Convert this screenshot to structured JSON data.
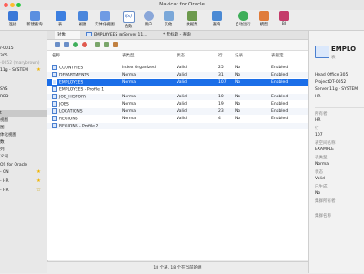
{
  "window": {
    "title": "Navicat for Oracle"
  },
  "colors": {
    "accent": "#1b6ee8",
    "traffic_close": "#ff5f57",
    "traffic_min": "#febc2e",
    "traffic_max": "#28c840"
  },
  "toolbar": [
    {
      "label": "连接",
      "icon": "connection-icon"
    },
    {
      "label": "新建查询",
      "icon": "new-query-icon"
    },
    {
      "label": "表",
      "icon": "table-icon"
    },
    {
      "label": "视图",
      "icon": "view-icon"
    },
    {
      "label": "实体化视图",
      "icon": "materialized-view-icon"
    },
    {
      "label": "函数",
      "icon": "function-icon"
    },
    {
      "label": "用户",
      "icon": "user-icon"
    },
    {
      "label": "其他",
      "icon": "other-icon"
    },
    {
      "label": "数据泵",
      "icon": "data-pump-icon"
    },
    {
      "label": "查询",
      "icon": "query-icon"
    },
    {
      "label": "自动运行",
      "icon": "automation-icon"
    },
    {
      "label": "模型",
      "icon": "model-icon"
    },
    {
      "label": "BI",
      "icon": "bi-icon"
    }
  ],
  "sidebar": [
    {
      "text": "r-0015"
    },
    {
      "text": "305"
    },
    {
      "text": "-0052 (marybrown)"
    },
    {
      "text": "11g - SYSTEM",
      "star": true
    },
    {
      "text": "SYS"
    },
    {
      "text": "RED"
    },
    {
      "text": "t",
      "selected": true
    },
    {
      "text": "视图"
    },
    {
      "text": "图"
    },
    {
      "text": "体化视图"
    },
    {
      "text": "数"
    },
    {
      "text": "列"
    },
    {
      "text": "义词"
    },
    {
      "text": "OS for Oracle"
    },
    {
      "text": "- CN",
      "star": true
    },
    {
      "text": "- HR",
      "star": true
    },
    {
      "text": "- HR",
      "star": false
    }
  ],
  "tabs": [
    {
      "label": "对象",
      "active": true
    },
    {
      "label": "EMPLOYEES @Server 11...",
      "active": false
    },
    {
      "label": "* 无标题 - 查询",
      "active": false
    }
  ],
  "grid": {
    "columns": [
      "名称",
      "表类型",
      "状态",
      "行",
      "记录",
      "表锁定"
    ],
    "rows": [
      {
        "name": "COUNTRIES",
        "type": "Index Organized",
        "status": "Valid",
        "rows": "25",
        "records": "No",
        "lock": "Enabled"
      },
      {
        "name": "DEPARTMENTS",
        "type": "Normal",
        "status": "Valid",
        "rows": "31",
        "records": "No",
        "lock": "Enabled"
      },
      {
        "name": "EMPLOYEES",
        "type": "Normal",
        "status": "Valid",
        "rows": "107",
        "records": "No",
        "lock": "Enabled",
        "selected": true
      },
      {
        "name": "EMPLOYEES - Profile 1",
        "type": "",
        "status": "",
        "rows": "",
        "records": "",
        "lock": "",
        "profile": true
      },
      {
        "name": "JOB_HISTORY",
        "type": "Normal",
        "status": "Valid",
        "rows": "10",
        "records": "No",
        "lock": "Enabled"
      },
      {
        "name": "JOBS",
        "type": "Normal",
        "status": "Valid",
        "rows": "19",
        "records": "No",
        "lock": "Enabled"
      },
      {
        "name": "LOCATIONS",
        "type": "Normal",
        "status": "Valid",
        "rows": "23",
        "records": "No",
        "lock": "Enabled"
      },
      {
        "name": "REGIONS",
        "type": "Normal",
        "status": "Valid",
        "rows": "4",
        "records": "No",
        "lock": "Enabled"
      },
      {
        "name": "REGIONS - Profile 2",
        "type": "",
        "status": "",
        "rows": "",
        "records": "",
        "lock": "",
        "profile": true
      }
    ]
  },
  "status": {
    "text": "18 个表, 18 个在当前的组"
  },
  "right_panel": {
    "title": "EMPLO",
    "subtitle": "表",
    "connections": [
      "Head Office 305",
      "ProjectDT-0052",
      "Server 11g - SYSTEM",
      "HR"
    ],
    "fields": [
      {
        "label": "所有者",
        "value": "HR"
      },
      {
        "label": "行",
        "value": "107"
      },
      {
        "label": "表空间名称",
        "value": "EXAMPLE"
      },
      {
        "label": "表类型",
        "value": "Normal"
      },
      {
        "label": "状态",
        "value": "Valid"
      },
      {
        "label": "已生成",
        "value": "No"
      },
      {
        "label": "集群所有者",
        "value": ""
      },
      {
        "label": "集群名称",
        "value": ""
      }
    ]
  }
}
